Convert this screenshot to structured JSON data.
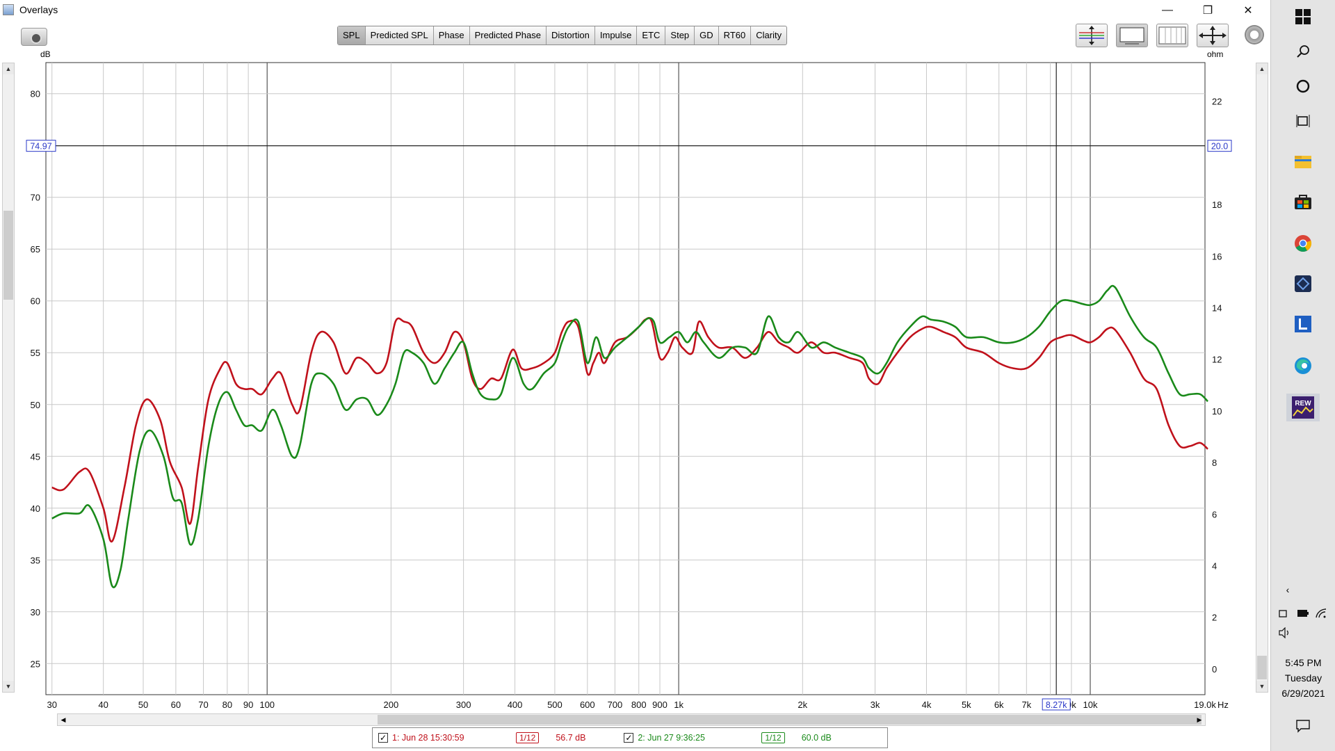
{
  "window": {
    "title": "Overlays",
    "minimize": "—",
    "maximize": "❐",
    "close": "✕"
  },
  "tabs": [
    "SPL",
    "Predicted SPL",
    "Phase",
    "Predicted Phase",
    "Distortion",
    "Impulse",
    "ETC",
    "Step",
    "GD",
    "RT60",
    "Clarity"
  ],
  "active_tab": "SPL",
  "icons": {
    "camera": "camera-icon",
    "tools": [
      "vertical-zoom-icon",
      "limits-icon",
      "grid-icon",
      "horizontal-zoom-icon"
    ],
    "settings": "gear-icon"
  },
  "units": {
    "left": "dB",
    "right": "ohm",
    "x_suffix": "Hz"
  },
  "cursor": {
    "level_db": "74.97",
    "ohm": "20.0",
    "freq_label": "8.27k",
    "freq_hz": 8270
  },
  "legend": [
    {
      "checked": "✓",
      "name": "1: Jun 28 15:30:59",
      "smoothing": "1/12",
      "value": "56.7 dB",
      "color": "#c0111b"
    },
    {
      "checked": "✓",
      "name": "2: Jun 27 9:36:25",
      "smoothing": "1/12",
      "value": "60.0 dB",
      "color": "#1a8a1a"
    }
  ],
  "taskbar": {
    "icons": [
      "windows-start-icon",
      "search-icon",
      "cortana-icon",
      "task-view-icon",
      "file-explorer-icon",
      "store-icon",
      "chrome-icon",
      "app-icon",
      "editor-icon",
      "edge-icon",
      "rew-icon"
    ],
    "tray": [
      "chevron-left-icon",
      "meet-now-icon",
      "battery-icon",
      "wifi-icon",
      "volume-icon"
    ],
    "time": "5:45 PM",
    "day": "Tuesday",
    "date": "6/29/2021",
    "notification_icon": "notification-icon"
  },
  "chart_data": {
    "type": "line",
    "xscale": "log",
    "xlim": [
      29,
      19000
    ],
    "ylim": [
      22,
      83
    ],
    "y2lim": [
      -1,
      23.5
    ],
    "x_ticks": [
      30,
      40,
      50,
      60,
      70,
      80,
      90,
      100,
      200,
      300,
      400,
      500,
      600,
      700,
      800,
      900,
      1000,
      2000,
      3000,
      4000,
      5000,
      6000,
      7000,
      10000,
      19000
    ],
    "x_tick_labels": [
      "30",
      "40",
      "50",
      "60",
      "70",
      "80",
      "90",
      "100",
      "200",
      "300",
      "400",
      "500",
      "600",
      "700",
      "800",
      "900",
      "1k",
      "2k",
      "3k",
      "4k",
      "5k",
      "6k",
      "7k",
      "10k",
      "19.0k"
    ],
    "hidden_tick_label": {
      "value": 9000,
      "label": "9k"
    },
    "y_ticks": [
      25,
      30,
      35,
      40,
      45,
      50,
      55,
      60,
      65,
      70,
      80
    ],
    "y_ticks_right": [
      0,
      2,
      4,
      6,
      8,
      10,
      12,
      14,
      16,
      18,
      22
    ],
    "grid": true,
    "series": [
      {
        "color": "#c0111b",
        "points": [
          [
            30,
            42
          ],
          [
            32,
            41.8
          ],
          [
            35,
            43.5
          ],
          [
            37,
            43.5
          ],
          [
            40,
            40
          ],
          [
            42,
            36.8
          ],
          [
            45,
            42
          ],
          [
            48,
            48
          ],
          [
            51,
            50.5
          ],
          [
            55,
            48.5
          ],
          [
            58,
            44.5
          ],
          [
            62,
            42
          ],
          [
            65,
            38.5
          ],
          [
            68,
            44
          ],
          [
            72,
            50.5
          ],
          [
            77,
            53.5
          ],
          [
            80,
            54
          ],
          [
            84,
            52
          ],
          [
            88,
            51.5
          ],
          [
            92,
            51.5
          ],
          [
            97,
            51
          ],
          [
            103,
            52.5
          ],
          [
            108,
            53
          ],
          [
            115,
            50
          ],
          [
            120,
            49.5
          ],
          [
            128,
            55
          ],
          [
            135,
            57
          ],
          [
            145,
            56
          ],
          [
            155,
            53
          ],
          [
            165,
            54.5
          ],
          [
            175,
            54
          ],
          [
            185,
            53
          ],
          [
            195,
            54
          ],
          [
            205,
            58
          ],
          [
            215,
            58
          ],
          [
            225,
            57.5
          ],
          [
            240,
            55
          ],
          [
            255,
            54
          ],
          [
            270,
            55
          ],
          [
            285,
            57
          ],
          [
            300,
            56
          ],
          [
            315,
            52.5
          ],
          [
            330,
            51.5
          ],
          [
            350,
            52.5
          ],
          [
            370,
            52.5
          ],
          [
            395,
            55.3
          ],
          [
            415,
            53.5
          ],
          [
            440,
            53.5
          ],
          [
            470,
            54
          ],
          [
            500,
            55
          ],
          [
            520,
            57
          ],
          [
            540,
            58
          ],
          [
            570,
            57.5
          ],
          [
            600,
            53
          ],
          [
            620,
            54
          ],
          [
            640,
            55
          ],
          [
            660,
            54
          ],
          [
            700,
            56
          ],
          [
            750,
            56.5
          ],
          [
            800,
            57.5
          ],
          [
            830,
            58.2
          ],
          [
            860,
            58
          ],
          [
            900,
            54.5
          ],
          [
            940,
            55
          ],
          [
            980,
            56.5
          ],
          [
            1020,
            55.5
          ],
          [
            1080,
            55
          ],
          [
            1120,
            58
          ],
          [
            1180,
            56.5
          ],
          [
            1250,
            55.5
          ],
          [
            1350,
            55.5
          ],
          [
            1450,
            54.5
          ],
          [
            1550,
            55.5
          ],
          [
            1650,
            57
          ],
          [
            1750,
            56
          ],
          [
            1850,
            55.5
          ],
          [
            1950,
            55
          ],
          [
            2100,
            56
          ],
          [
            2250,
            55
          ],
          [
            2400,
            55
          ],
          [
            2600,
            54.5
          ],
          [
            2800,
            54
          ],
          [
            2900,
            52.5
          ],
          [
            3050,
            52
          ],
          [
            3200,
            53.5
          ],
          [
            3400,
            55
          ],
          [
            3650,
            56.5
          ],
          [
            3900,
            57.3
          ],
          [
            4100,
            57.5
          ],
          [
            4400,
            57
          ],
          [
            4700,
            56.5
          ],
          [
            5000,
            55.5
          ],
          [
            5500,
            55
          ],
          [
            6000,
            54
          ],
          [
            6500,
            53.5
          ],
          [
            7000,
            53.5
          ],
          [
            7500,
            54.5
          ],
          [
            8000,
            56
          ],
          [
            8500,
            56.5
          ],
          [
            9000,
            56.7
          ],
          [
            9600,
            56.2
          ],
          [
            10000,
            56
          ],
          [
            10500,
            56.5
          ],
          [
            11000,
            57.3
          ],
          [
            11500,
            57.2
          ],
          [
            12500,
            55
          ],
          [
            13500,
            52.5
          ],
          [
            14500,
            51.5
          ],
          [
            15500,
            48
          ],
          [
            16500,
            46
          ],
          [
            17500,
            46
          ],
          [
            18500,
            46.3
          ],
          [
            19300,
            45.7
          ]
        ]
      },
      {
        "color": "#1a8a1a",
        "points": [
          [
            30,
            39
          ],
          [
            32,
            39.5
          ],
          [
            35,
            39.5
          ],
          [
            37,
            40.2
          ],
          [
            40,
            37
          ],
          [
            42,
            32.5
          ],
          [
            44,
            34
          ],
          [
            46,
            39
          ],
          [
            49,
            45.5
          ],
          [
            52,
            47.5
          ],
          [
            56,
            45
          ],
          [
            59,
            41
          ],
          [
            62,
            40.5
          ],
          [
            65,
            36.5
          ],
          [
            68,
            39
          ],
          [
            72,
            46
          ],
          [
            76,
            50
          ],
          [
            80,
            51.2
          ],
          [
            84,
            49.5
          ],
          [
            88,
            48
          ],
          [
            92,
            48
          ],
          [
            97,
            47.5
          ],
          [
            103,
            49.5
          ],
          [
            108,
            48
          ],
          [
            115,
            45
          ],
          [
            120,
            46
          ],
          [
            128,
            52
          ],
          [
            135,
            53
          ],
          [
            145,
            52
          ],
          [
            155,
            49.5
          ],
          [
            165,
            50.5
          ],
          [
            175,
            50.5
          ],
          [
            185,
            49
          ],
          [
            195,
            50
          ],
          [
            205,
            52
          ],
          [
            215,
            55
          ],
          [
            225,
            55
          ],
          [
            240,
            54
          ],
          [
            255,
            52
          ],
          [
            270,
            53.5
          ],
          [
            285,
            55
          ],
          [
            300,
            56
          ],
          [
            315,
            53
          ],
          [
            330,
            51
          ],
          [
            350,
            50.5
          ],
          [
            370,
            51
          ],
          [
            395,
            54.5
          ],
          [
            420,
            52
          ],
          [
            440,
            51.5
          ],
          [
            470,
            53
          ],
          [
            500,
            54
          ],
          [
            520,
            56
          ],
          [
            540,
            57.5
          ],
          [
            570,
            58
          ],
          [
            600,
            54
          ],
          [
            630,
            56.5
          ],
          [
            660,
            54.5
          ],
          [
            700,
            55.5
          ],
          [
            750,
            56.5
          ],
          [
            800,
            57.5
          ],
          [
            840,
            58.3
          ],
          [
            870,
            58
          ],
          [
            900,
            56
          ],
          [
            950,
            56.5
          ],
          [
            1000,
            57
          ],
          [
            1050,
            56
          ],
          [
            1100,
            57
          ],
          [
            1150,
            56
          ],
          [
            1250,
            54.5
          ],
          [
            1350,
            55.5
          ],
          [
            1450,
            55.5
          ],
          [
            1550,
            55
          ],
          [
            1650,
            58.5
          ],
          [
            1750,
            56.5
          ],
          [
            1850,
            56
          ],
          [
            1950,
            57
          ],
          [
            2100,
            55.5
          ],
          [
            2250,
            56
          ],
          [
            2400,
            55.5
          ],
          [
            2600,
            55
          ],
          [
            2800,
            54.5
          ],
          [
            2900,
            53.5
          ],
          [
            3050,
            53
          ],
          [
            3200,
            54
          ],
          [
            3400,
            56
          ],
          [
            3650,
            57.5
          ],
          [
            3900,
            58.5
          ],
          [
            4100,
            58.2
          ],
          [
            4400,
            58
          ],
          [
            4700,
            57.5
          ],
          [
            5000,
            56.5
          ],
          [
            5500,
            56.5
          ],
          [
            6000,
            56
          ],
          [
            6500,
            56
          ],
          [
            7000,
            56.5
          ],
          [
            7500,
            57.5
          ],
          [
            8000,
            59
          ],
          [
            8500,
            60
          ],
          [
            9000,
            60
          ],
          [
            9600,
            59.7
          ],
          [
            10000,
            59.6
          ],
          [
            10500,
            60
          ],
          [
            11000,
            61
          ],
          [
            11500,
            61.3
          ],
          [
            12500,
            58.5
          ],
          [
            13500,
            56.5
          ],
          [
            14500,
            55.5
          ],
          [
            15500,
            53
          ],
          [
            16500,
            51
          ],
          [
            17500,
            51
          ],
          [
            18500,
            51
          ],
          [
            19300,
            50.3
          ]
        ]
      }
    ]
  }
}
